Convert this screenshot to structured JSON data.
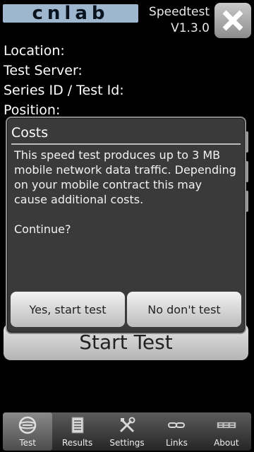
{
  "header": {
    "logo_text": "cnlab",
    "app_name": "Speedtest",
    "version": "V1.3.0"
  },
  "info": {
    "location_label": "Location:",
    "server_label": "Test Server:",
    "series_label": "Series ID / Test Id:",
    "position_label": "Position:"
  },
  "start_button": {
    "label": "Start Test"
  },
  "dialog": {
    "title": "Costs",
    "message": "This speed test produces up to 3 MB mobile network data traffic. Depending on your mobile contract this may cause additional costs.",
    "question": "Continue?",
    "yes_label": "Yes, start test",
    "no_label": "No don't test"
  },
  "tabs": [
    {
      "label": "Test",
      "icon": "globe-icon",
      "active": true
    },
    {
      "label": "Results",
      "icon": "document-icon",
      "active": false
    },
    {
      "label": "Settings",
      "icon": "tools-icon",
      "active": false
    },
    {
      "label": "Links",
      "icon": "link-icon",
      "active": false
    },
    {
      "label": "About",
      "icon": "cnlab-logo-icon",
      "active": false
    }
  ],
  "colors": {
    "logo_bg": "#9eb7cf",
    "dialog_bg": "#3a3a3a",
    "background": "#000000"
  }
}
